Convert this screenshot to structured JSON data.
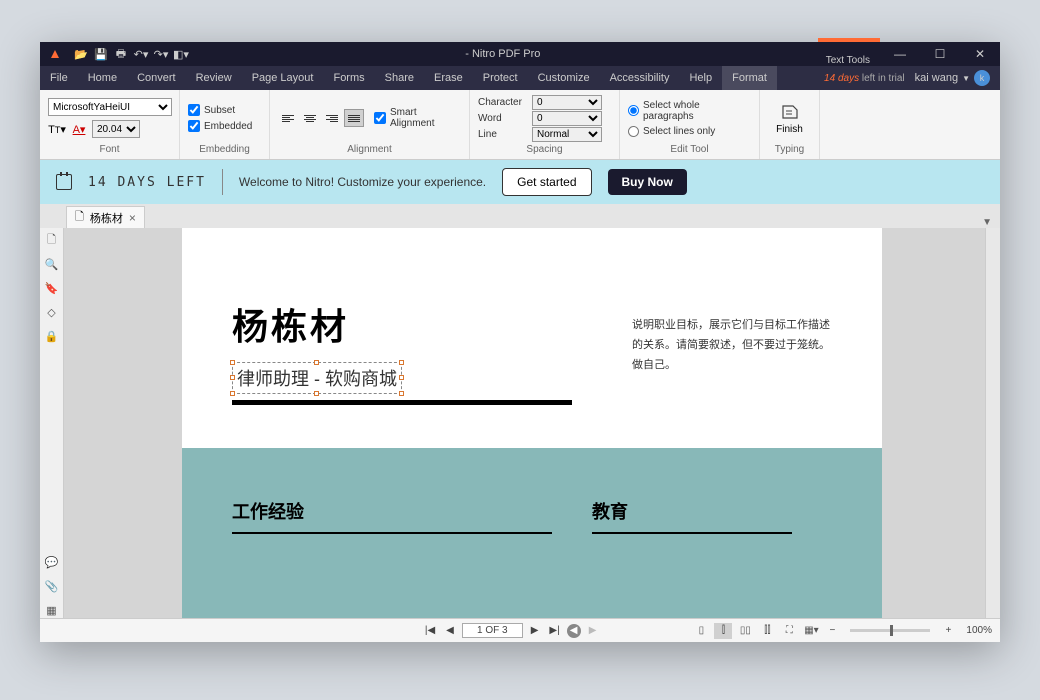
{
  "app": {
    "title": "- Nitro PDF Pro"
  },
  "qat": [
    "open",
    "save",
    "print",
    "undo",
    "redo",
    "customize"
  ],
  "texttools": {
    "group_label": "Text Tools",
    "active_tab": "Format"
  },
  "winbtns": {
    "min": "—",
    "max": "☐",
    "close": "✕"
  },
  "menu": [
    "File",
    "Home",
    "Convert",
    "Review",
    "Page Layout",
    "Forms",
    "Share",
    "Erase",
    "Protect",
    "Customize",
    "Accessibility",
    "Help"
  ],
  "trial": {
    "days": "14 days",
    "suffix": "left in trial"
  },
  "user": {
    "name": "kai wang",
    "initial": "k"
  },
  "ribbon": {
    "font": {
      "label": "Font",
      "family": "MicrosoftYaHeiUI",
      "size": "20.04"
    },
    "embedding": {
      "label": "Embedding",
      "subset": "Subset",
      "embedded": "Embedded"
    },
    "alignment": {
      "label": "Alignment",
      "smart": "Smart Alignment"
    },
    "spacing": {
      "label": "Spacing",
      "character": "Character",
      "word": "Word",
      "line": "Line",
      "char_val": "0",
      "word_val": "0",
      "line_val": "Normal"
    },
    "edittool": {
      "label": "Edit Tool",
      "whole": "Select whole paragraphs",
      "lines": "Select lines only"
    },
    "typing": {
      "label": "Typing",
      "finish": "Finish"
    }
  },
  "promo": {
    "days_left": "14 DAYS LEFT",
    "welcome": "Welcome to Nitro! Customize your experience.",
    "get_started": "Get started",
    "buy_now": "Buy Now"
  },
  "doc_tab": {
    "name": "杨栋材"
  },
  "page": {
    "name": "杨栋材",
    "subtitle": "律师助理 - 软购商城",
    "desc_l1": "说明职业目标，展示它们与目标工作描述",
    "desc_l2": "的关系。请简要叙述，但不要过于笼统。",
    "desc_l3": "做自己。",
    "section1": "工作经验",
    "section2": "教育"
  },
  "status": {
    "page_ind": "1 OF 3",
    "zoom": "100%"
  }
}
